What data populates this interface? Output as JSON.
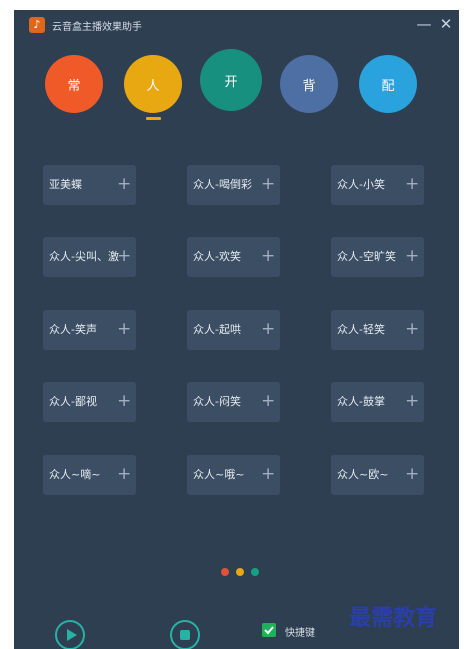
{
  "window": {
    "title": "云音盒主播效果助手",
    "logo_glyph": "♪",
    "minimize_glyph": "—",
    "close_glyph": "✕"
  },
  "categories": [
    {
      "label": "常",
      "color": "#f05a28",
      "selected": false
    },
    {
      "label": "人",
      "color": "#e8a812",
      "selected": true
    },
    {
      "label": "开",
      "color": "#17907f",
      "selected": false
    },
    {
      "label": "背",
      "color": "#4e6fa4",
      "selected": false
    },
    {
      "label": "配",
      "color": "#2aa2dd",
      "selected": false
    }
  ],
  "sounds": [
    {
      "label": "亚美蝶"
    },
    {
      "label": "众人-喝倒彩"
    },
    {
      "label": "众人-小笑"
    },
    {
      "label": "众人-尖叫、激"
    },
    {
      "label": "众人-欢笑"
    },
    {
      "label": "众人-空旷笑"
    },
    {
      "label": "众人-笑声"
    },
    {
      "label": "众人-起哄"
    },
    {
      "label": "众人-轻笑"
    },
    {
      "label": "众人-鄙视"
    },
    {
      "label": "众人-闷笑"
    },
    {
      "label": "众人-鼓掌"
    },
    {
      "label": "众人~嘀~"
    },
    {
      "label": "众人~哦~"
    },
    {
      "label": "众人~欧~"
    }
  ],
  "add_glyph": "+",
  "pager": {
    "dots": [
      "#e0533a",
      "#e8a812",
      "#16a085"
    ]
  },
  "controls": {
    "play_icon": "play-icon",
    "stop_icon": "stop-icon"
  },
  "hotkey": {
    "label": "快捷键",
    "checked": true
  },
  "watermark": "最需教育"
}
